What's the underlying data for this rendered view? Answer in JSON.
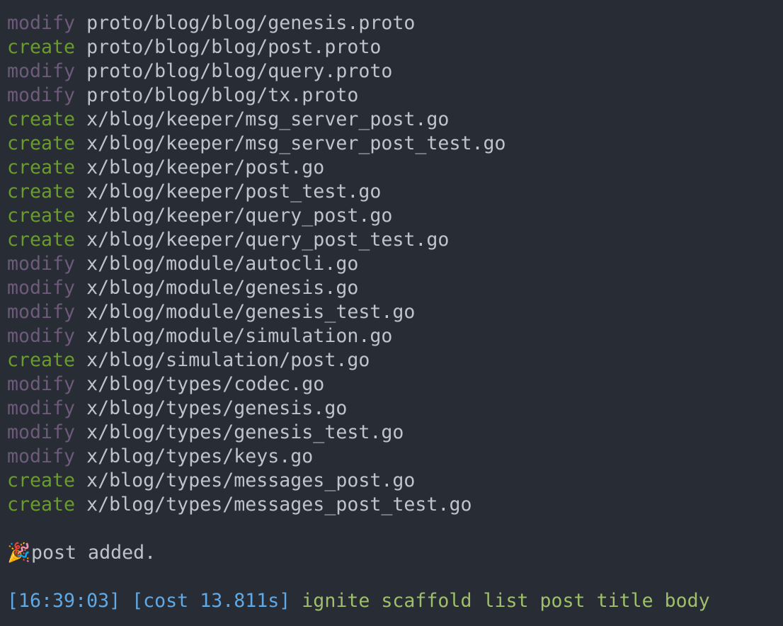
{
  "files": [
    {
      "action": "modify",
      "path": "proto/blog/blog/genesis.proto"
    },
    {
      "action": "create",
      "path": "proto/blog/blog/post.proto"
    },
    {
      "action": "modify",
      "path": "proto/blog/blog/query.proto"
    },
    {
      "action": "modify",
      "path": "proto/blog/blog/tx.proto"
    },
    {
      "action": "create",
      "path": "x/blog/keeper/msg_server_post.go"
    },
    {
      "action": "create",
      "path": "x/blog/keeper/msg_server_post_test.go"
    },
    {
      "action": "create",
      "path": "x/blog/keeper/post.go"
    },
    {
      "action": "create",
      "path": "x/blog/keeper/post_test.go"
    },
    {
      "action": "create",
      "path": "x/blog/keeper/query_post.go"
    },
    {
      "action": "create",
      "path": "x/blog/keeper/query_post_test.go"
    },
    {
      "action": "modify",
      "path": "x/blog/module/autocli.go"
    },
    {
      "action": "modify",
      "path": "x/blog/module/genesis.go"
    },
    {
      "action": "modify",
      "path": "x/blog/module/genesis_test.go"
    },
    {
      "action": "modify",
      "path": "x/blog/module/simulation.go"
    },
    {
      "action": "create",
      "path": "x/blog/simulation/post.go"
    },
    {
      "action": "modify",
      "path": "x/blog/types/codec.go"
    },
    {
      "action": "modify",
      "path": "x/blog/types/genesis.go"
    },
    {
      "action": "modify",
      "path": "x/blog/types/genesis_test.go"
    },
    {
      "action": "modify",
      "path": "x/blog/types/keys.go"
    },
    {
      "action": "create",
      "path": "x/blog/types/messages_post.go"
    },
    {
      "action": "create",
      "path": "x/blog/types/messages_post_test.go"
    }
  ],
  "success": {
    "icon": "party-popper-icon",
    "emoji": "🎉",
    "message": "post added."
  },
  "prompt": {
    "time": "[16:39:03]",
    "cost": "[cost 13.811s]",
    "command": "ignite scaffold list post title body"
  }
}
